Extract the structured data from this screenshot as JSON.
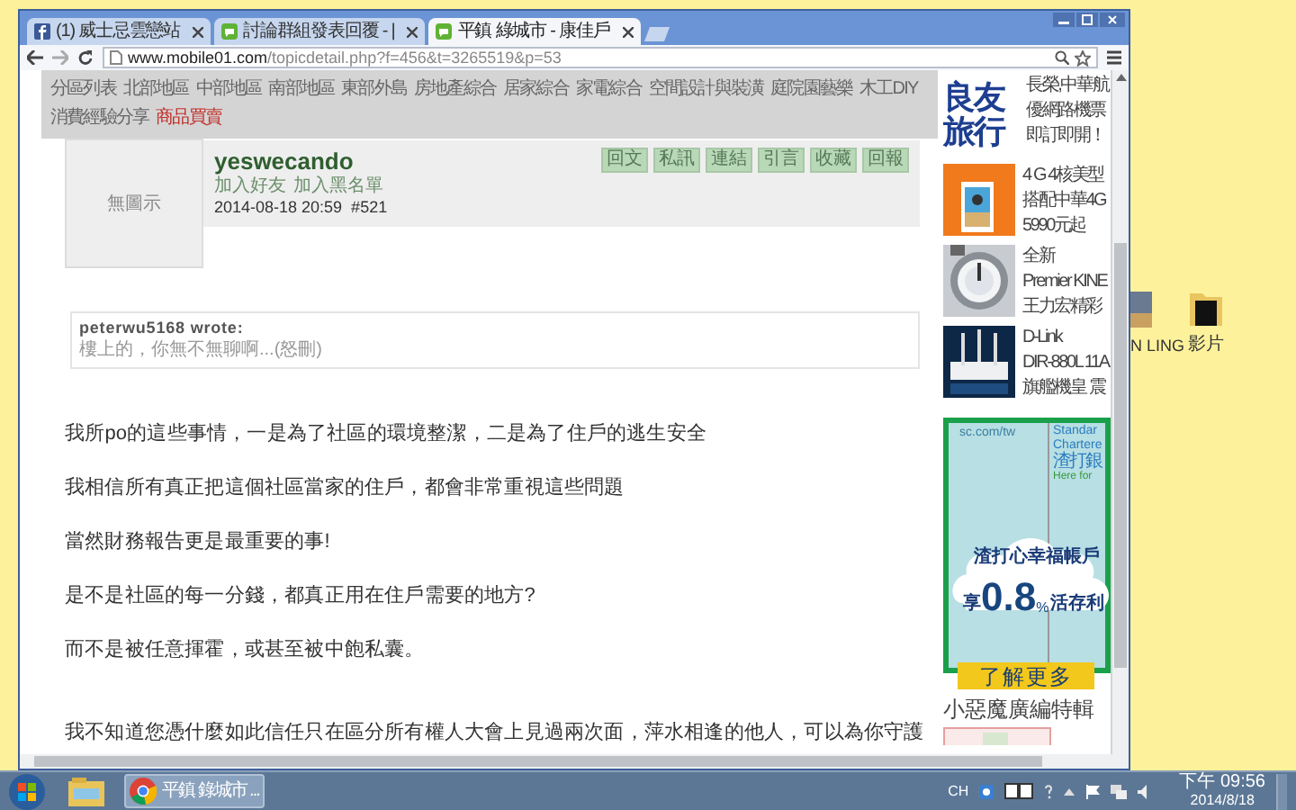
{
  "browser": {
    "tabs": [
      {
        "kind": "facebook",
        "title": "(1) 威士忌雲戀站",
        "selected": false
      },
      {
        "kind": "chat",
        "title": "討論群組發表回覆 - |",
        "selected": false
      },
      {
        "kind": "chat",
        "title": "平鎮 綠城市 - 康佳戶",
        "selected": true
      }
    ],
    "address_bar": {
      "host": "www.mobile01.com",
      "path": "/topicdetail.php?f=456&t=3265519&p=53"
    }
  },
  "nav": {
    "rows": [
      [
        {
          "label": "分區列表",
          "emphasized": false
        },
        {
          "label": "北部地區",
          "emphasized": false
        },
        {
          "label": "中部地區",
          "emphasized": false
        },
        {
          "label": "南部地區",
          "emphasized": false
        },
        {
          "label": "東部外島",
          "emphasized": false
        },
        {
          "label": "房地產綜合",
          "emphasized": false
        },
        {
          "label": "居家綜合",
          "emphasized": false
        },
        {
          "label": "家電綜合",
          "emphasized": false
        },
        {
          "label": "空間設計與裝潢",
          "emphasized": false
        },
        {
          "label": "庭院園藝樂",
          "emphasized": false
        },
        {
          "label": "木工DIY",
          "emphasized": false
        }
      ],
      [
        {
          "label": "消費經驗分享",
          "emphasized": false
        },
        {
          "label": "商品買賣",
          "emphasized": true
        }
      ]
    ]
  },
  "post": {
    "avatar_label": "無圖示",
    "username": "yeswecando",
    "links": [
      "加入好友",
      "加入黑名單"
    ],
    "meta": "2014-08-18 20:59  #521",
    "buttons": [
      "回文",
      "私訊",
      "連結",
      "引言",
      "收藏",
      "回報"
    ],
    "quote": {
      "author": "peterwu5168 wrote:",
      "text": "樓上的，你無不無聊啊...(怒刪)"
    },
    "paragraphs": [
      "我所po的這些事情，一是為了社區的環境整潔，二是為了住戶的逃生安全",
      "我相信所有真正把這個社區當家的住戶，都會非常重視這些問題",
      "當然財務報告更是最重要的事!",
      "是不是社區的每一分錢，都真正用在住戶需要的地方?",
      "而不是被任意揮霍，或甚至被中飽私囊。",
      "我不知道您憑什麼如此信任只在區分所有權人大會上見過兩次面，萍水相逢的他人，可以為你守護"
    ]
  },
  "sidebar": {
    "ads": [
      {
        "kind": "logo",
        "logo": "良友旅行",
        "lines": [
          "長榮,中華航",
          "優網路機票",
          "即訂即開！"
        ]
      },
      {
        "kind": "picture",
        "lines": [
          "4 G 4核美型",
          "搭配中華4G",
          "5990元起"
        ]
      },
      {
        "kind": "picture",
        "lines": [
          "全新",
          "Premier KINE",
          "王力宏精彩"
        ]
      },
      {
        "kind": "picture",
        "lines": [
          "D-Link",
          "DIR-880L 11A",
          "旗艦機皇 震"
        ]
      }
    ],
    "banner": {
      "url": "sc.com/tw",
      "brand": [
        "Standar",
        "Chartere"
      ],
      "brand_cn": "渣打銀",
      "tagline": "Here for",
      "headline": "渣打心幸福帳戶",
      "rate_prefix": "享",
      "rate": "0.8",
      "rate_unit": "%",
      "rate_suffix": "活存利",
      "cta": "了解更多"
    },
    "section_title": "小惡魔廣編特輯"
  },
  "desktop_icons": [
    {
      "label": "N LING"
    },
    {
      "label": "影片"
    }
  ],
  "taskbar": {
    "task": "平鎮 錄城市 ...",
    "language": "CH",
    "time": "下午 09:56",
    "date": "2014/8/18"
  }
}
